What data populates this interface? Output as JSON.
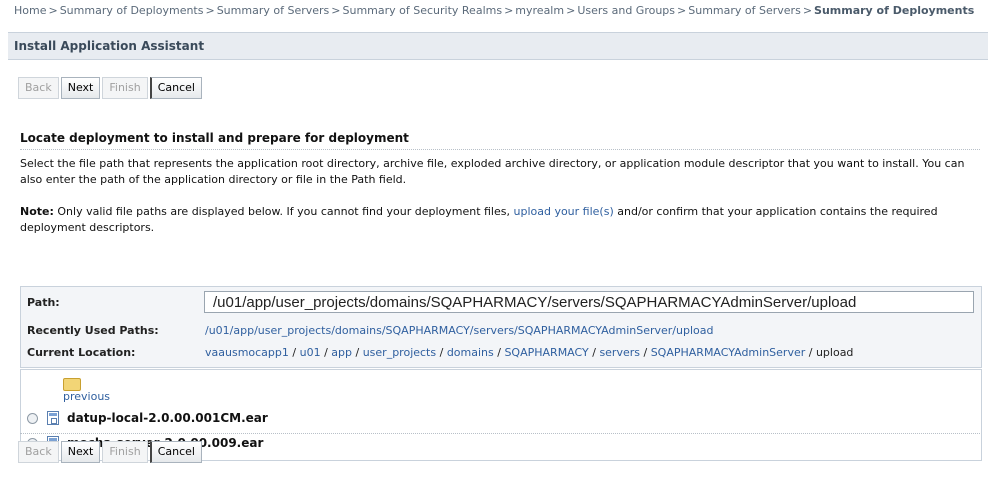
{
  "breadcrumb": {
    "items": [
      "Home",
      "Summary of Deployments",
      "Summary of Servers",
      "Summary of Security Realms",
      "myrealm",
      "Users and Groups",
      "Summary of Servers",
      "Summary of Deployments"
    ],
    "separator": ">"
  },
  "panel": {
    "title": "Install Application Assistant"
  },
  "buttons": {
    "back": "Back",
    "next": "Next",
    "finish": "Finish",
    "cancel": "Cancel"
  },
  "section": {
    "title": "Locate deployment to install and prepare for deployment",
    "description": "Select the file path that represents the application root directory, archive file, exploded archive directory, or application module descriptor that you want to install. You can also enter the path of the application directory or file in the Path field.",
    "note_label": "Note:",
    "note_text_1": " Only valid file paths are displayed below. If you cannot find your deployment files, ",
    "note_link": "upload your file(s)",
    "note_text_2": " and/or confirm that your application contains the required deployment descriptors."
  },
  "path": {
    "label": "Path:",
    "value": "/u01/app/user_projects/domains/SQAPHARMACY/servers/SQAPHARMACYAdminServer/upload",
    "recent_label": "Recently Used Paths:",
    "recent_value": "/u01/app/user_projects/domains/SQAPHARMACY/servers/SQAPHARMACYAdminServer/upload",
    "location_label": "Current Location:",
    "location": [
      "vaausmocapp1",
      "u01",
      "app",
      "user_projects",
      "domains",
      "SQAPHARMACY",
      "servers",
      "SQAPHARMACYAdminServer",
      "upload"
    ],
    "location_sep": " / "
  },
  "files": {
    "previous": "previous",
    "items": [
      {
        "name": "datup-local-2.0.00.001CM.ear",
        "selected": false
      },
      {
        "name": "mocha-server-2.0.00.009.ear",
        "selected": true
      }
    ]
  }
}
